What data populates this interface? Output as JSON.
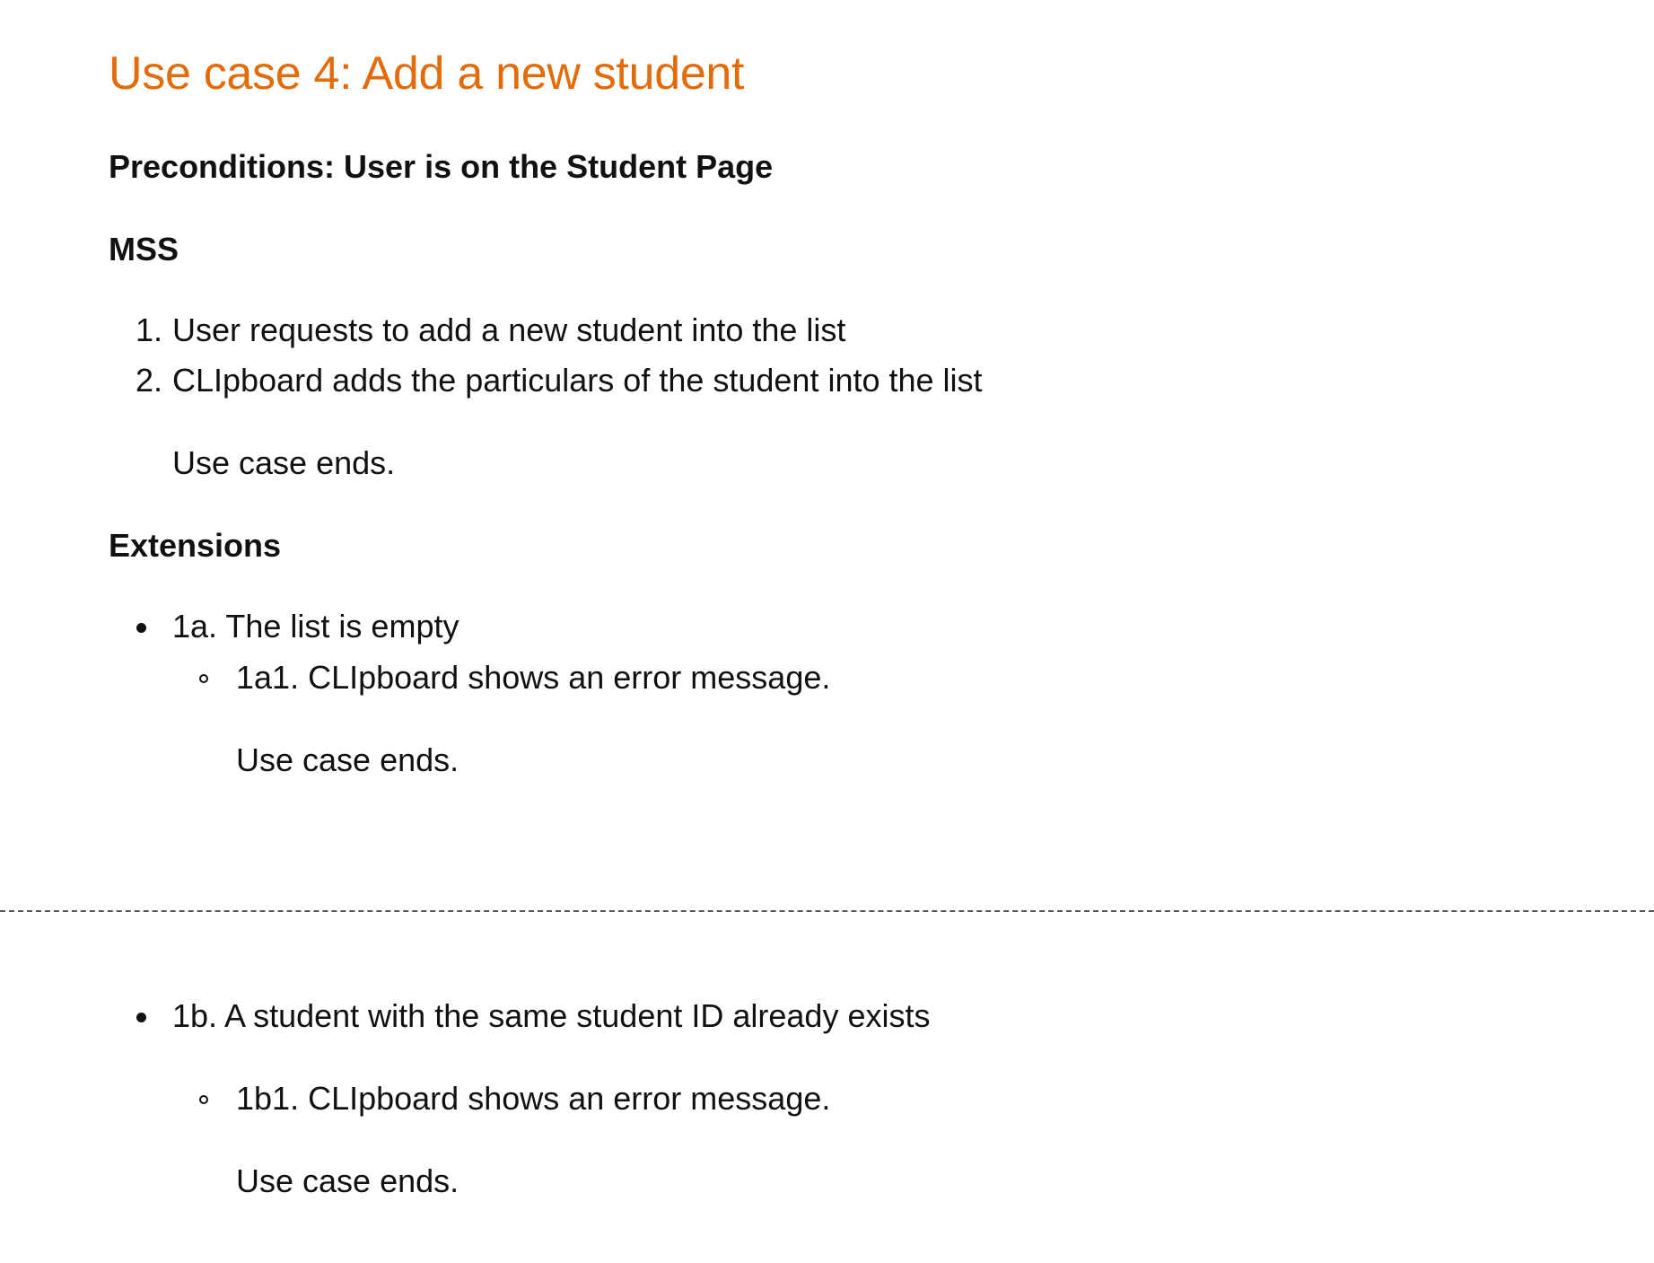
{
  "theme": {
    "title_color": "#E36C0A",
    "text_color": "#111111",
    "divider_color": "#555555"
  },
  "doc": {
    "title": "Use case 4: Add a new student",
    "preconditions": "Preconditions: User is on the Student Page",
    "mss_heading": "MSS",
    "mss_steps": [
      {
        "marker": "1.",
        "text": "User requests to add a new student into the list"
      },
      {
        "marker": "2.",
        "text": "CLIpboard adds the particulars of the student into the list"
      }
    ],
    "mss_end": "Use case ends.",
    "extensions_heading": "Extensions",
    "extensions": [
      {
        "text": "1a. The list is empty",
        "sub": "1a1. CLIpboard shows an error message.",
        "end": "Use case ends."
      },
      {
        "text": "1b. A student with the same student ID already exists",
        "sub": "1b1. CLIpboard shows an error message.",
        "end": "Use case ends."
      }
    ]
  }
}
